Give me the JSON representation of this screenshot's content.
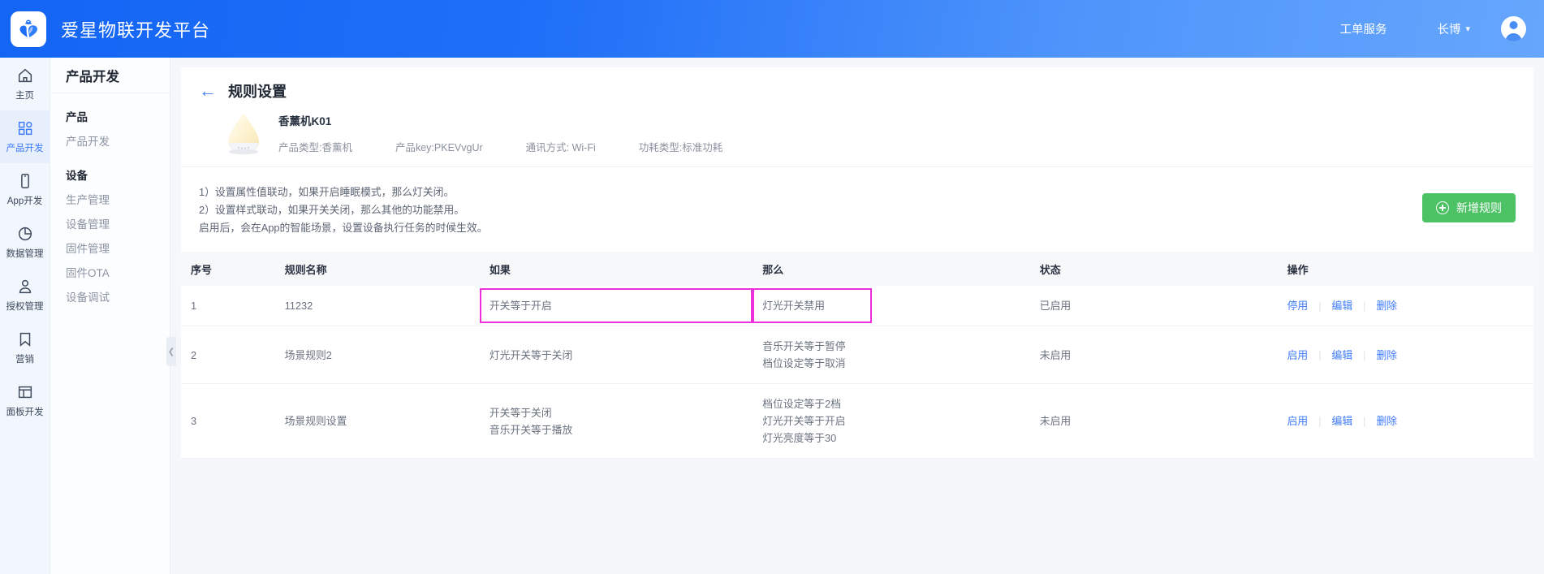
{
  "topbar": {
    "brand": "爱星物联开发平台",
    "service_link": "工单服务",
    "user_name": "长博",
    "chevron": "⌄",
    "logo_icon": "heart-leaf-logo-icon",
    "avatar_icon": "user-avatar-icon"
  },
  "rail": {
    "items": [
      {
        "label": "主页",
        "icon": "home-icon",
        "active": false
      },
      {
        "label": "产品开发",
        "icon": "grid-squares-icon",
        "active": true
      },
      {
        "label": "App开发",
        "icon": "mobile-phone-icon",
        "active": false
      },
      {
        "label": "数据管理",
        "icon": "pie-chart-icon",
        "active": false
      },
      {
        "label": "授权管理",
        "icon": "user-person-icon",
        "active": false
      },
      {
        "label": "营销",
        "icon": "bookmark-icon",
        "active": false
      },
      {
        "label": "面板开发",
        "icon": "layout-panel-icon",
        "active": false
      }
    ]
  },
  "subnav": {
    "title": "产品开发",
    "items": [
      {
        "label": "产品",
        "group": true
      },
      {
        "label": "产品开发",
        "group": false
      },
      {
        "label": "设备",
        "group": true,
        "spacer": true
      },
      {
        "label": "生产管理",
        "group": false
      },
      {
        "label": "设备管理",
        "group": false
      },
      {
        "label": "固件管理",
        "group": false
      },
      {
        "label": "固件OTA",
        "group": false
      },
      {
        "label": "设备调试",
        "group": false
      }
    ],
    "collapse_icon": "chevron-left-icon"
  },
  "page": {
    "back_icon": "arrow-left-icon",
    "title": "规则设置",
    "product": {
      "image_icon": "aroma-diffuser-product-image",
      "name": "香薰机K01",
      "meta": [
        "产品类型:香薰机",
        "产品key:PKEVvgUr",
        "通讯方式: Wi-Fi",
        "功耗类型:标准功耗"
      ]
    },
    "description": [
      "1）设置属性值联动，如果开启睡眠模式，那么灯关闭。",
      "2）设置样式联动，如果开关关闭，那么其他的功能禁用。",
      "启用后，会在App的智能场景，设置设备执行任务的时候生效。"
    ],
    "add_rule_label": "新增规则",
    "add_rule_icon": "plus-circle-icon",
    "add_rule_color": "#4cc265"
  },
  "table": {
    "headers": [
      "序号",
      "规则名称",
      "如果",
      "那么",
      "状态",
      "操作"
    ],
    "rows": [
      {
        "index": "1",
        "name": "11232",
        "if": [
          "开关等于开启"
        ],
        "then": [
          "灯光开关禁用"
        ],
        "status": "已启用",
        "status_on": true,
        "ops": [
          "停用",
          "编辑",
          "删除"
        ],
        "highlight": true
      },
      {
        "index": "2",
        "name": "场景规则2",
        "if": [
          "灯光开关等于关闭"
        ],
        "then": [
          "音乐开关等于暂停",
          "档位设定等于取消"
        ],
        "status": "未启用",
        "status_on": false,
        "ops": [
          "启用",
          "编辑",
          "删除"
        ],
        "highlight": false
      },
      {
        "index": "3",
        "name": "场景规则设置",
        "if": [
          "开关等于关闭",
          "音乐开关等于播放"
        ],
        "then": [
          "档位设定等于2档",
          "灯光开关等于开启",
          "灯光亮度等于30"
        ],
        "status": "未启用",
        "status_on": false,
        "ops": [
          "启用",
          "编辑",
          "删除"
        ],
        "highlight": false
      }
    ],
    "highlight_color": "#ec30db",
    "status_on_color": "#52c41a",
    "link_color": "#3e7bfa"
  }
}
